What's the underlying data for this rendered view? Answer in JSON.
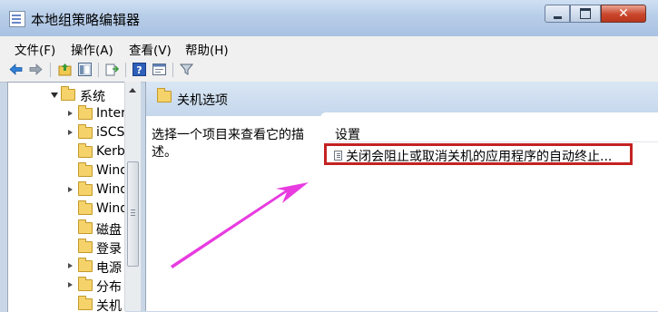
{
  "window": {
    "title": "本地组策略编辑器"
  },
  "menu": [
    "文件(F)",
    "操作(A)",
    "查看(V)",
    "帮助(H)"
  ],
  "tree": [
    {
      "label": "系统",
      "expander": "down"
    },
    {
      "label": "Inter",
      "expander": "right"
    },
    {
      "label": "iSCS",
      "expander": "right"
    },
    {
      "label": "Kerb",
      "expander": ""
    },
    {
      "label": "Wind",
      "expander": ""
    },
    {
      "label": "Wind",
      "expander": "right"
    },
    {
      "label": "Wind",
      "expander": ""
    },
    {
      "label": "磁盘",
      "expander": ""
    },
    {
      "label": "登录",
      "expander": ""
    },
    {
      "label": "电源",
      "expander": "right"
    },
    {
      "label": "分布",
      "expander": "right"
    },
    {
      "label": "关机",
      "expander": ""
    }
  ],
  "right_pane": {
    "title": "关机选项",
    "description": "选择一个项目来查看它的描述。",
    "column_header": "设置",
    "policy_item": "关闭会阻止或取消关机的应用程序的自动终止..."
  },
  "colors": {
    "highlight_border": "#c42222",
    "annotation_arrow": "#e83be0"
  }
}
